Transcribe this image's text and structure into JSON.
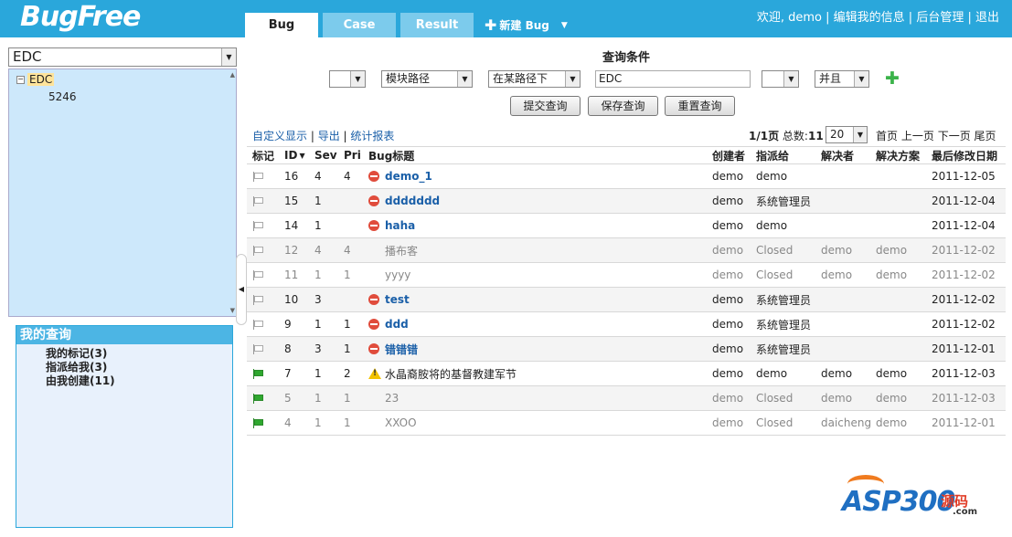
{
  "header": {
    "logo": "BugFree",
    "tabs": [
      {
        "label": "Bug",
        "active": true
      },
      {
        "label": "Case",
        "active": false
      },
      {
        "label": "Result",
        "active": false
      }
    ],
    "new_bug_label": "新建 Bug",
    "user_links": {
      "welcome": "欢迎, demo",
      "edit_profile": "编辑我的信息",
      "admin": "后台管理",
      "logout": "退出"
    }
  },
  "sidebar": {
    "project_select": "EDC",
    "tree": {
      "root": "EDC",
      "child": "5246"
    },
    "my_queries": {
      "title": "我的查询",
      "items": [
        "我的标记(3)",
        "指派给我(3)",
        "由我创建(11)"
      ]
    }
  },
  "query": {
    "title": "查询条件",
    "field_select": "",
    "path_select": "模块路径",
    "operator_select": "在某路径下",
    "value": "EDC",
    "extra_select": "",
    "logic_select": "并且",
    "buttons": {
      "submit": "提交查询",
      "save": "保存查询",
      "reset": "重置查询"
    }
  },
  "listbar": {
    "custom_display": "自定义显示",
    "export": "导出",
    "report": "统计报表",
    "page_info": "1/1页",
    "total_label": "总数:",
    "total": "11",
    "page_size": "20",
    "first": "首页",
    "prev": "上一页",
    "next": "下一页",
    "last": "尾页"
  },
  "table": {
    "headers": {
      "flag": "标记",
      "id": "ID",
      "sev": "Sev",
      "pri": "Pri",
      "title": "Bug标题",
      "creator": "创建者",
      "assigned": "指派给",
      "resolver": "解决者",
      "resolution": "解决方案",
      "date": "最后修改日期"
    },
    "rows": [
      {
        "flag": false,
        "id": "16",
        "sev": "4",
        "pri": "4",
        "icon": "stop",
        "title": "demo_1",
        "creator": "demo",
        "assigned": "demo",
        "resolver": "",
        "resolution": "",
        "date": "2011-12-05",
        "state": "active"
      },
      {
        "flag": false,
        "id": "15",
        "sev": "1",
        "pri": "",
        "icon": "stop",
        "title": "ddddddd",
        "creator": "demo",
        "assigned": "系统管理员",
        "resolver": "",
        "resolution": "",
        "date": "2011-12-04",
        "state": "active"
      },
      {
        "flag": false,
        "id": "14",
        "sev": "1",
        "pri": "",
        "icon": "stop",
        "title": "haha",
        "creator": "demo",
        "assigned": "demo",
        "resolver": "",
        "resolution": "",
        "date": "2011-12-04",
        "state": "active"
      },
      {
        "flag": false,
        "id": "12",
        "sev": "4",
        "pri": "4",
        "icon": "",
        "title": "播布客",
        "creator": "demo",
        "assigned": "Closed",
        "resolver": "demo",
        "resolution": "demo",
        "date": "2011-12-02",
        "state": "closed"
      },
      {
        "flag": false,
        "id": "11",
        "sev": "1",
        "pri": "1",
        "icon": "",
        "title": "yyyy",
        "creator": "demo",
        "assigned": "Closed",
        "resolver": "demo",
        "resolution": "demo",
        "date": "2011-12-02",
        "state": "closed"
      },
      {
        "flag": false,
        "id": "10",
        "sev": "3",
        "pri": "",
        "icon": "stop",
        "title": "test",
        "creator": "demo",
        "assigned": "系统管理员",
        "resolver": "",
        "resolution": "",
        "date": "2011-12-02",
        "state": "active"
      },
      {
        "flag": false,
        "id": "9",
        "sev": "1",
        "pri": "1",
        "icon": "stop",
        "title": "ddd",
        "creator": "demo",
        "assigned": "系统管理员",
        "resolver": "",
        "resolution": "",
        "date": "2011-12-02",
        "state": "active"
      },
      {
        "flag": false,
        "id": "8",
        "sev": "3",
        "pri": "1",
        "icon": "stop",
        "title": "错错错",
        "creator": "demo",
        "assigned": "系统管理员",
        "resolver": "",
        "resolution": "",
        "date": "2011-12-01",
        "state": "active"
      },
      {
        "flag": true,
        "id": "7",
        "sev": "1",
        "pri": "2",
        "icon": "warn",
        "title": "水晶裔胺将的基督教建军节",
        "creator": "demo",
        "assigned": "demo",
        "resolver": "demo",
        "resolution": "demo",
        "date": "2011-12-03",
        "state": "resolved"
      },
      {
        "flag": true,
        "id": "5",
        "sev": "1",
        "pri": "1",
        "icon": "",
        "title": "23",
        "creator": "demo",
        "assigned": "Closed",
        "resolver": "demo",
        "resolution": "demo",
        "date": "2011-12-03",
        "state": "closed"
      },
      {
        "flag": true,
        "id": "4",
        "sev": "1",
        "pri": "1",
        "icon": "",
        "title": "XXOO",
        "creator": "demo",
        "assigned": "Closed",
        "resolver": "daicheng",
        "resolution": "demo",
        "date": "2011-12-01",
        "state": "closed"
      }
    ]
  },
  "watermark": {
    "brand": "ASP300",
    "cn": "源码",
    "domain": ".com"
  },
  "colors": {
    "topbar": "#2aa7db",
    "link": "#1a5fa8",
    "tree_bg": "#cde8fb",
    "add_green": "#3bb34a"
  }
}
